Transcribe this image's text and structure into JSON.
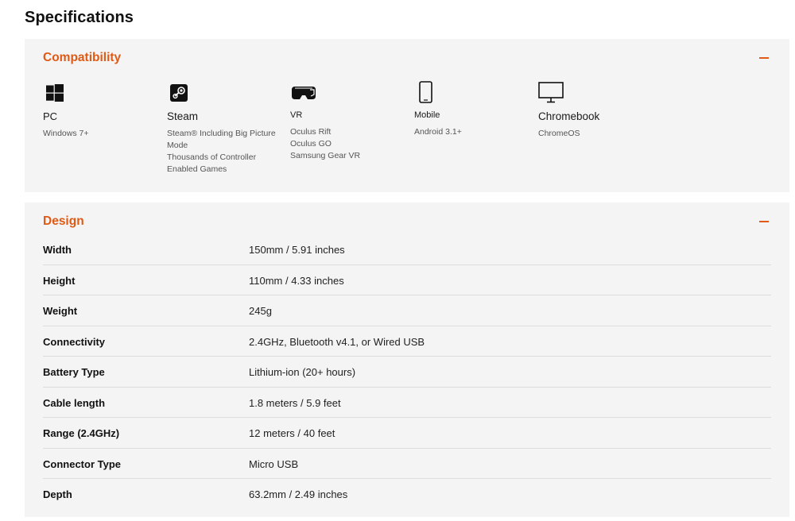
{
  "page_title": "Specifications",
  "accent_color": "#e05a16",
  "compatibility": {
    "title": "Compatibility",
    "collapse_icon": "minus-icon",
    "platforms": [
      {
        "icon": "windows-icon",
        "name": "PC",
        "details": [
          "Windows 7+"
        ]
      },
      {
        "icon": "steam-icon",
        "name": "Steam",
        "details": [
          "Steam® Including Big Picture",
          "Mode",
          "Thousands of Controller",
          "Enabled Games"
        ]
      },
      {
        "icon": "vr-headset-icon",
        "name": "VR",
        "details": [
          "Oculus Rift",
          "Oculus GO",
          "Samsung Gear VR"
        ]
      },
      {
        "icon": "smartphone-icon",
        "name": "Mobile",
        "details": [
          "Android 3.1+"
        ]
      },
      {
        "icon": "monitor-icon",
        "name": "Chromebook",
        "details": [
          "ChromeOS"
        ]
      }
    ]
  },
  "design": {
    "title": "Design",
    "collapse_icon": "minus-icon",
    "specs": [
      {
        "label": "Width",
        "value": "150mm / 5.91 inches"
      },
      {
        "label": "Height",
        "value": "110mm / 4.33 inches"
      },
      {
        "label": "Weight",
        "value": "245g"
      },
      {
        "label": "Connectivity",
        "value": "2.4GHz, Bluetooth v4.1, or Wired USB"
      },
      {
        "label": "Battery Type",
        "value": "Lithium-ion (20+ hours)"
      },
      {
        "label": "Cable length",
        "value": "1.8 meters / 5.9 feet"
      },
      {
        "label": "Range (2.4GHz)",
        "value": "12 meters / 40 feet"
      },
      {
        "label": "Connector Type",
        "value": "Micro USB"
      },
      {
        "label": "Depth",
        "value": "63.2mm / 2.49 inches"
      }
    ]
  }
}
